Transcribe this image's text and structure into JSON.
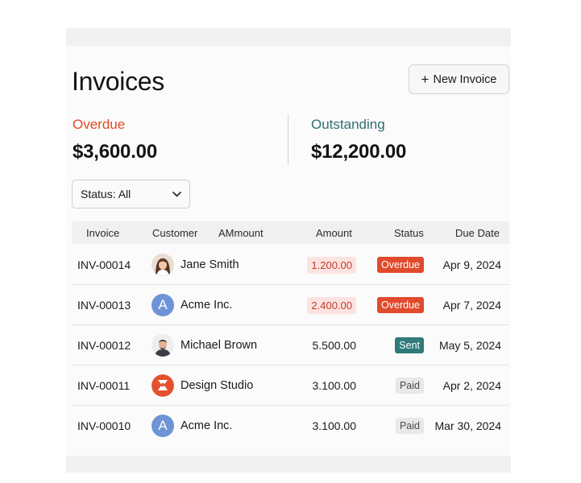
{
  "page": {
    "title": "Invoices",
    "new_button_label": "New Invoice",
    "new_button_icon": "plus-icon"
  },
  "summary": {
    "overdue_label": "Overdue",
    "overdue_value": "$3,600.00",
    "outstanding_label": "Outstanding",
    "outstanding_value": "$12,200.00"
  },
  "filter": {
    "selected": "Status: All",
    "icon": "chevron-down-icon"
  },
  "table": {
    "headers": [
      "Invoice",
      "Customer",
      "AMmount",
      "Amount",
      "Status",
      "Due Date"
    ],
    "rows": [
      {
        "invoice": "INV-00014",
        "customer": "Jane Smith",
        "avatar": "person-photo",
        "amount": "1.200.00",
        "status": "Overdue",
        "due": "Apr 9, 2024"
      },
      {
        "invoice": "INV-00013",
        "customer": "Acme Inc.",
        "avatar": "A",
        "amount": "2.400.00",
        "status": "Overdue",
        "due": "Apr 7, 2024"
      },
      {
        "invoice": "INV-00012",
        "customer": "Michael Brown",
        "avatar": "person-photo",
        "amount": "5.500.00",
        "status": "Sent",
        "due": "May 5, 2024"
      },
      {
        "invoice": "INV-00011",
        "customer": "Design Studio",
        "avatar": "logo",
        "amount": "3.100.00",
        "status": "Paid",
        "due": "Apr 2, 2024"
      },
      {
        "invoice": "INV-00010",
        "customer": "Acme Inc.",
        "avatar": "A",
        "amount": "3.100.00",
        "status": "Paid",
        "due": "Mar 30, 2024"
      }
    ]
  },
  "colors": {
    "overdue": "#e34a24",
    "outstanding": "#2f6f73",
    "sent": "#2f7a7a",
    "avatar_letter": "#6e93d6"
  }
}
